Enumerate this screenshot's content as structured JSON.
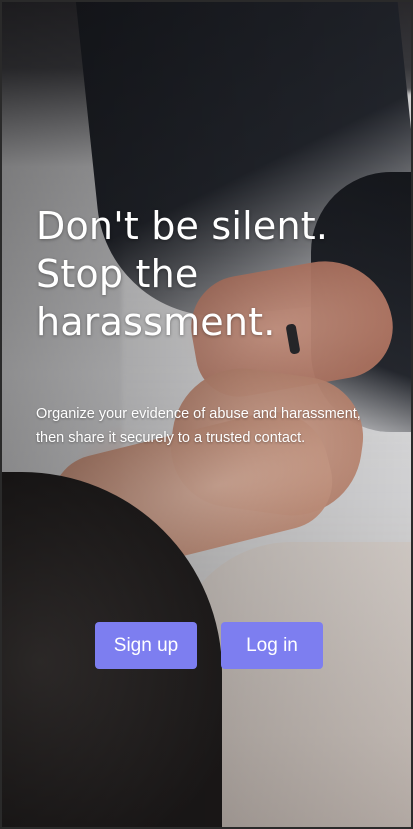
{
  "hero": {
    "headline_lines": [
      "Don't be silent.",
      "Stop the",
      "harassment."
    ],
    "subtitle": "Organize your evidence of abuse and harassment, then share it securely to a trusted contact."
  },
  "actions": {
    "signup_label": "Sign up",
    "login_label": "Log in"
  },
  "colors": {
    "button_bg": "#7d7ef0",
    "text": "#ffffff"
  }
}
